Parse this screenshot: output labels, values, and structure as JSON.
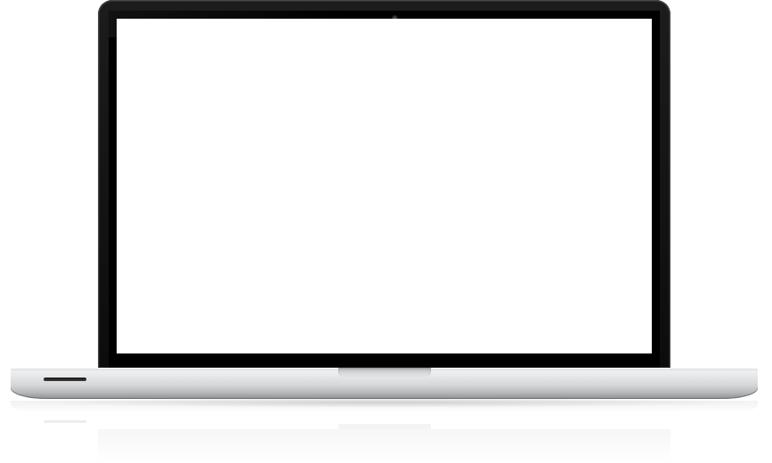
{
  "device": {
    "type": "laptop",
    "screen_state": "blank",
    "colors": {
      "bezel": "#000000",
      "screen": "#ffffff",
      "aluminum_light": "#e8e9ea",
      "aluminum_dark": "#8e8f92",
      "background": "#ffffff"
    }
  }
}
